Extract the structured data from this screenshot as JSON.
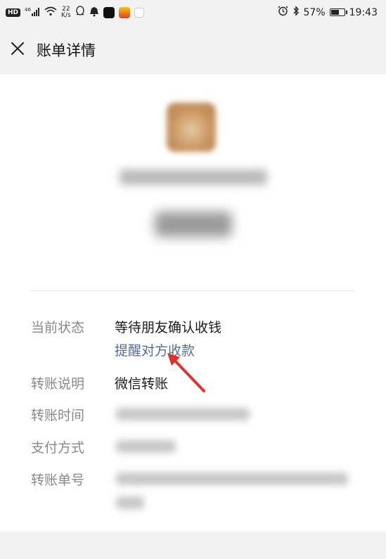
{
  "status_bar": {
    "hd": "HD",
    "signal": "46",
    "net_speed_value": "22",
    "net_speed_unit": "K/s",
    "battery_percent": "57%",
    "time": "19:43"
  },
  "header": {
    "title": "账单详情",
    "close_icon": "close-icon"
  },
  "details": {
    "status_label": "当前状态",
    "status_value": "等待朋友确认收钱",
    "remind_link": "提醒对方收款",
    "note_label": "转账说明",
    "note_value": "微信转账",
    "time_label": "转账时间",
    "payment_label": "支付方式",
    "order_label": "转账单号"
  },
  "colors": {
    "link": "#586c94",
    "arrow": "#e03131",
    "label": "#888888"
  }
}
